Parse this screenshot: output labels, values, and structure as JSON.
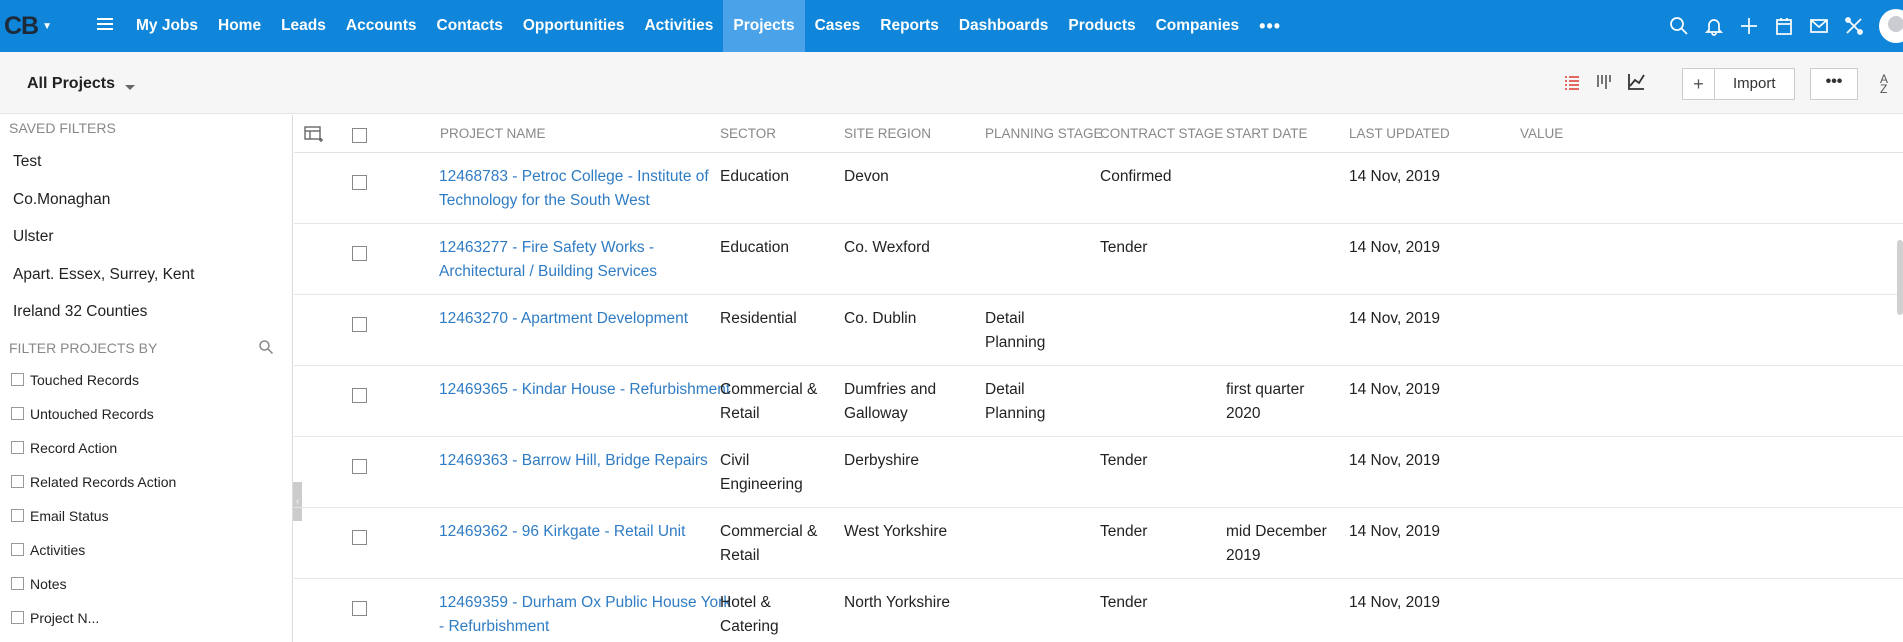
{
  "app": {
    "logo": "CB"
  },
  "nav": {
    "tabs": [
      "My Jobs",
      "Home",
      "Leads",
      "Accounts",
      "Contacts",
      "Opportunities",
      "Activities",
      "Projects",
      "Cases",
      "Reports",
      "Dashboards",
      "Products",
      "Companies"
    ],
    "active": "Projects",
    "more": "•••"
  },
  "header_icons": [
    "search-icon",
    "bell-icon",
    "plus-icon",
    "calendar-icon",
    "mail-icon",
    "tools-icon",
    "avatar"
  ],
  "toolbar": {
    "view_label": "All Projects",
    "plus": "+",
    "import_label": "Import",
    "more_label": "•••",
    "sort_label": "A↓Z"
  },
  "sidebar": {
    "saved_filters_title": "SAVED FILTERS",
    "saved_filters": [
      "Test",
      "Co.Monaghan",
      "Ulster",
      "Apart. Essex, Surrey, Kent",
      "Ireland 32 Counties"
    ],
    "filter_by_title": "FILTER PROJECTS BY",
    "filter_by": [
      "Touched Records",
      "Untouched Records",
      "Record Action",
      "Related Records Action",
      "Email Status",
      "Activities",
      "Notes",
      "Project N..."
    ]
  },
  "table": {
    "columns": {
      "project_name": "PROJECT NAME",
      "sector": "SECTOR",
      "site_region": "SITE REGION",
      "planning_stage": "PLANNING STAGE",
      "contract_stage": "CONTRACT STAGE",
      "start_date": "START DATE",
      "last_updated": "LAST UPDATED",
      "value": "VALUE"
    },
    "rows": [
      {
        "name1": "12468783 - Petroc College - Institute of",
        "name2": "Technology for the South West",
        "sector1": "Education",
        "sector2": "",
        "region1": "Devon",
        "region2": "",
        "planning1": "",
        "planning2": "",
        "contract": "Confirmed",
        "start1": "",
        "start2": "",
        "updated": "14 Nov, 2019"
      },
      {
        "name1": "12463277 - Fire Safety Works -",
        "name2": "Architectural / Building Services",
        "sector1": "Education",
        "sector2": "",
        "region1": "Co. Wexford",
        "region2": "",
        "planning1": "",
        "planning2": "",
        "contract": "Tender",
        "start1": "",
        "start2": "",
        "updated": "14 Nov, 2019"
      },
      {
        "name1": "12463270 - Apartment Development",
        "name2": "",
        "sector1": "Residential",
        "sector2": "",
        "region1": "Co. Dublin",
        "region2": "",
        "planning1": "Detail",
        "planning2": "Planning",
        "contract": "",
        "start1": "",
        "start2": "",
        "updated": "14 Nov, 2019"
      },
      {
        "name1": "12469365 - Kindar House - Refurbishment",
        "name2": "",
        "sector1": "Commercial &",
        "sector2": "Retail",
        "region1": "Dumfries and",
        "region2": "Galloway",
        "planning1": "Detail",
        "planning2": "Planning",
        "contract": "",
        "start1": "first quarter",
        "start2": "2020",
        "updated": "14 Nov, 2019"
      },
      {
        "name1": "12469363 - Barrow Hill, Bridge Repairs",
        "name2": "",
        "sector1": "Civil",
        "sector2": "Engineering",
        "region1": "Derbyshire",
        "region2": "",
        "planning1": "",
        "planning2": "",
        "contract": "Tender",
        "start1": "",
        "start2": "",
        "updated": "14 Nov, 2019"
      },
      {
        "name1": "12469362 - 96 Kirkgate - Retail Unit",
        "name2": "",
        "sector1": "Commercial &",
        "sector2": "Retail",
        "region1": "West Yorkshire",
        "region2": "",
        "planning1": "",
        "planning2": "",
        "contract": "Tender",
        "start1": "mid December",
        "start2": "2019",
        "updated": "14 Nov, 2019"
      },
      {
        "name1": "12469359 - Durham Ox Public House York",
        "name2": "- Refurbishment",
        "sector1": "Hotel &",
        "sector2": "Catering",
        "region1": "North Yorkshire",
        "region2": "",
        "planning1": "",
        "planning2": "",
        "contract": "Tender",
        "start1": "",
        "start2": "",
        "updated": "14 Nov, 2019"
      }
    ]
  },
  "colors": {
    "topbar": "#0f86d9",
    "active_tab": "#4aa3e8",
    "link": "#2f7cc4"
  }
}
